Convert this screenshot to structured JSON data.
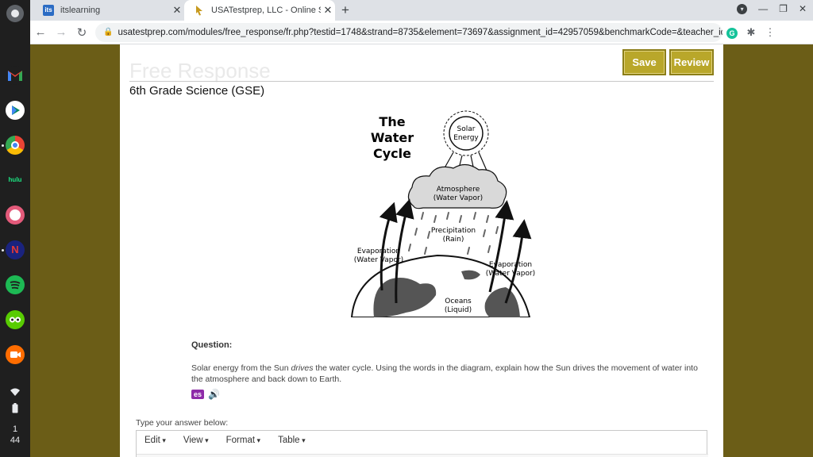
{
  "browser": {
    "tabs": [
      {
        "title": "itslearning",
        "icon": "itslearning-favicon",
        "favicon_text": "its"
      },
      {
        "title": "USATestprep, LLC - Online State",
        "icon": "usatestprep-favicon"
      }
    ],
    "url": "usatestprep.com/modules/free_response/fr.php?testid=1748&strand=8735&element=73697&assignment_id=42957059&benchmarkCode=&teacher_id=..."
  },
  "shelf": {
    "clock_hour": "1",
    "clock_minute": "44",
    "apps": [
      "gmail",
      "google-play",
      "chrome",
      "hulu",
      "app-icon",
      "app-icon-2",
      "spotify",
      "duolingo",
      "video-app"
    ],
    "hulu_label": "hulu"
  },
  "page": {
    "section_title": "Free Response",
    "grade": "6th Grade Science (GSE)",
    "save_label": "Save",
    "review_label": "Review",
    "diagram": {
      "title_line1": "The",
      "title_line2": "Water",
      "title_line3": "Cycle",
      "sun_line1": "Solar",
      "sun_line2": "Energy",
      "cloud_line1": "Atmosphere",
      "cloud_line2": "(Water Vapor)",
      "precip_line1": "Precipitation",
      "precip_line2": "(Rain)",
      "evap_left_line1": "Evaporation",
      "evap_left_line2": "(Water Vapor)",
      "evap_right_line1": "Evaporation",
      "evap_right_line2": "(Water Vapor)",
      "ocean_line1": "Oceans",
      "ocean_line2": "(Liquid)"
    },
    "question_label": "Question:",
    "question_before": "Solar energy from the Sun ",
    "question_em": "drives",
    "question_after": " the water cycle. Using the words in the diagram, explain how the Sun drives the movement of water into the atmosphere and back down to Earth.",
    "spanish_label": "es",
    "answer_prompt": "Type your answer below:",
    "editor_menu": [
      "Edit",
      "View",
      "Format",
      "Table"
    ]
  },
  "colors": {
    "page_background": "#6b5d17",
    "button": "#b9a72a",
    "spanish_badge": "#8e2ca8"
  }
}
